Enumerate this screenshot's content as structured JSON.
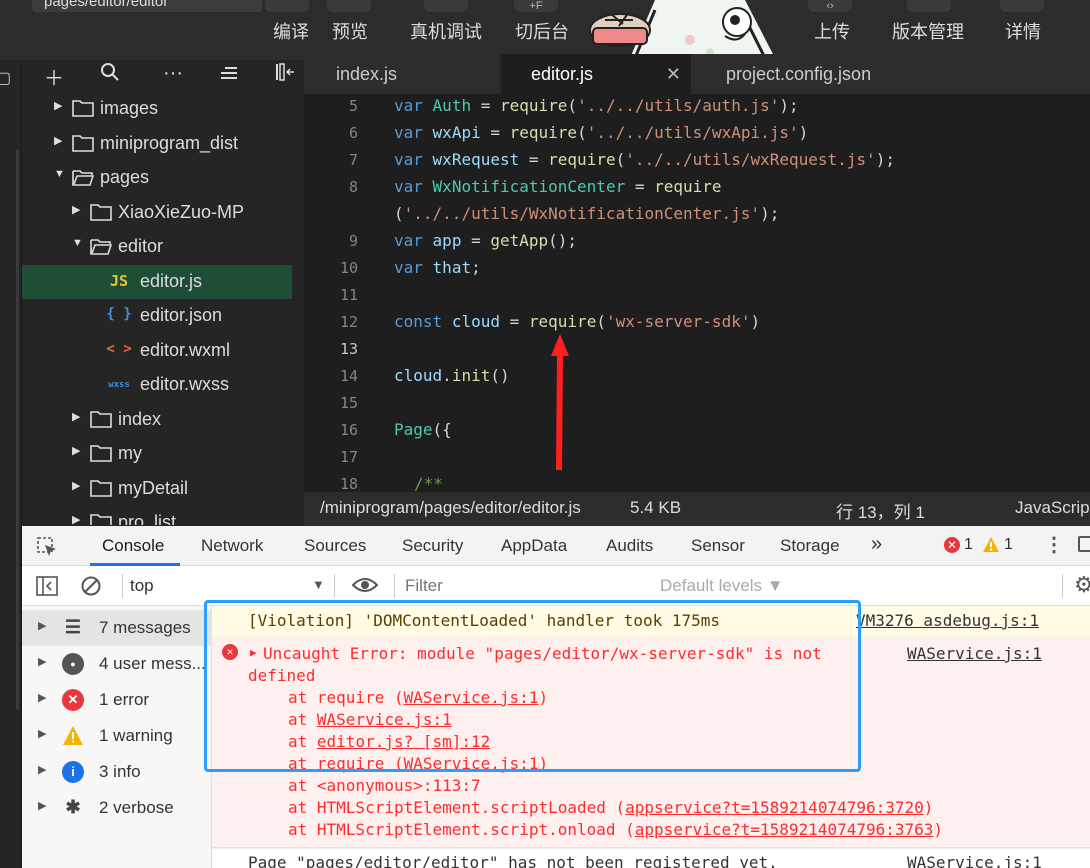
{
  "toolbar": {
    "path": "pages/editor/editor",
    "compile": "编译",
    "preview": "预览",
    "device_debug": "真机调试",
    "background": "切后台",
    "upload": "上传",
    "version": "版本管理",
    "details": "详情"
  },
  "explorer": {
    "items": [
      {
        "label": "images",
        "type": "folder",
        "expanded": false
      },
      {
        "label": "miniprogram_dist",
        "type": "folder",
        "expanded": false
      },
      {
        "label": "pages",
        "type": "folder",
        "expanded": true
      },
      {
        "label": "XiaoXieZuo-MP",
        "type": "folder",
        "expanded": false
      },
      {
        "label": "editor",
        "type": "folder",
        "expanded": true
      },
      {
        "label": "editor.js",
        "type": "js",
        "icon": "JS"
      },
      {
        "label": "editor.json",
        "type": "json",
        "icon": "{ }"
      },
      {
        "label": "editor.wxml",
        "type": "wxml",
        "icon": "< >"
      },
      {
        "label": "editor.wxss",
        "type": "wxss",
        "icon": "wxss"
      },
      {
        "label": "index",
        "type": "folder",
        "expanded": false
      },
      {
        "label": "my",
        "type": "folder",
        "expanded": false
      },
      {
        "label": "myDetail",
        "type": "folder",
        "expanded": false
      },
      {
        "label": "pro_list",
        "type": "folder",
        "expanded": false
      }
    ]
  },
  "tabs": [
    {
      "label": "index.js"
    },
    {
      "label": "editor.js",
      "close": "✕"
    },
    {
      "label": "project.config.json"
    }
  ],
  "code": {
    "line_numbers": [
      "5",
      "6",
      "7",
      "8",
      "",
      "9",
      "10",
      "11",
      "12",
      "13",
      "14",
      "15",
      "16",
      "17",
      "18"
    ]
  },
  "status": {
    "path": "/miniprogram/pages/editor/editor.js",
    "size": "5.4 KB",
    "position": "行 13，列 1",
    "language": "JavaScript"
  },
  "devtools": {
    "tabs": [
      "Console",
      "Network",
      "Sources",
      "Security",
      "AppData",
      "Audits",
      "Sensor",
      "Storage",
      "»"
    ],
    "error_count": "1",
    "warning_count": "1",
    "context": "top",
    "filter_placeholder": "Filter",
    "levels": "Default levels ▼",
    "sidebar": [
      {
        "label": "7 messages",
        "icon": "list-icon"
      },
      {
        "label": "4 user mess...",
        "icon": "user-icon"
      },
      {
        "label": "1 error",
        "icon": "error-icon"
      },
      {
        "label": "1 warning",
        "icon": "warning-icon"
      },
      {
        "label": "3 info",
        "icon": "info-icon"
      },
      {
        "label": "2 verbose",
        "icon": "bug-icon"
      }
    ],
    "log": {
      "violation": "[Violation] 'DOMContentLoaded' handler took 175ms",
      "violation_src": "VM3276 asdebug.js:1",
      "error_head": "Uncaught Error: module \"pages/editor/wx-server-sdk\" is not",
      "error_head2": "defined",
      "error_src": "WAService.js:1",
      "at": "at",
      "stack": [
        {
          "fn": "require (",
          "link": "WAService.js:1",
          "tail": ")"
        },
        {
          "fn": "",
          "link": "WAService.js:1",
          "tail": ""
        },
        {
          "fn": "",
          "link": "editor.js? [sm]:12",
          "tail": ""
        },
        {
          "fn": "require (",
          "link": "WAService.js:1",
          "tail": ")"
        },
        {
          "fn": "<anonymous>:113:7",
          "link": "",
          "tail": ""
        },
        {
          "fn": "HTMLScriptElement.scriptLoaded (",
          "link": "appservice?t=1589214074796:3720",
          "tail": ")"
        },
        {
          "fn": "HTMLScriptElement.script.onload (",
          "link": "appservice?t=1589214074796:3763",
          "tail": ")"
        }
      ],
      "last": "Page \"pages/editor/editor\" has not been registered yet.",
      "last_src": "WAService.js:1"
    }
  },
  "colors": {
    "accent": "#1a73e8",
    "highlight_box": "#2c9cff",
    "arrow": "#ff1f1f",
    "active_file": "#1f4e36"
  }
}
